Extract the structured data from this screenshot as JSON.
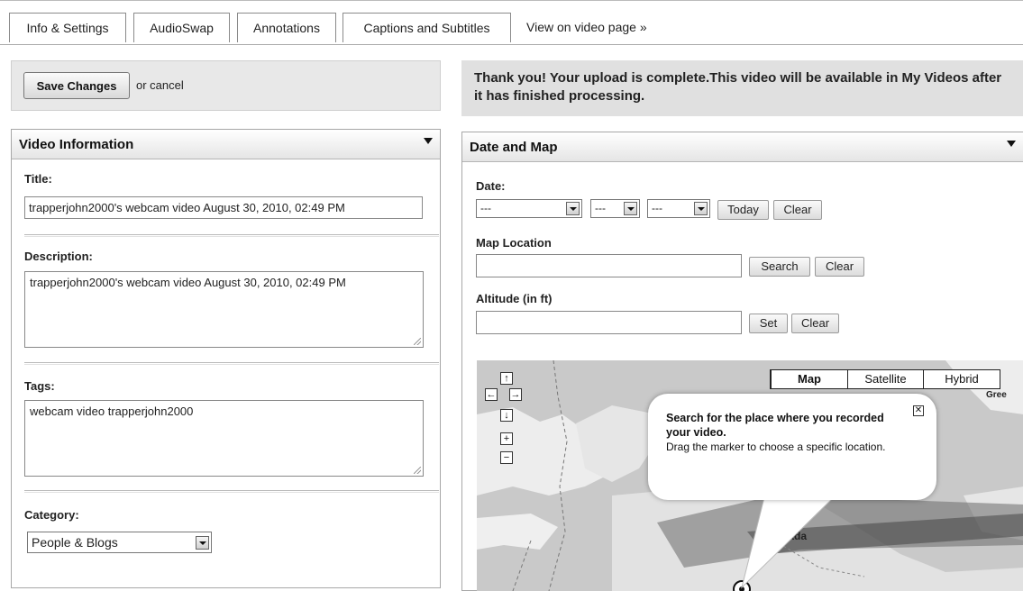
{
  "tabs": [
    {
      "label": "Info & Settings"
    },
    {
      "label": "AudioSwap"
    },
    {
      "label": "Annotations"
    },
    {
      "label": "Captions and Subtitles"
    }
  ],
  "tab_link": "View on video page »",
  "save_bar": {
    "save_label": "Save Changes",
    "cancel_text": "or cancel"
  },
  "banner": {
    "message": "Thank you! Your upload is complete.This video will be available in My Videos after it has finished processing."
  },
  "video_info": {
    "title": "Video Information",
    "title_label": "Title:",
    "title_value": "trapperjohn2000's webcam video August 30, 2010, 02:49 PM",
    "description_label": "Description:",
    "description_value": "trapperjohn2000's webcam video August 30, 2010, 02:49 PM",
    "tags_label": "Tags:",
    "tags_value": "webcam video trapperjohn2000",
    "category_label": "Category:",
    "category_value": "People & Blogs"
  },
  "date_map": {
    "title": "Date and Map",
    "date_label": "Date:",
    "date_month": "---",
    "date_day": "---",
    "date_year": "---",
    "today_label": "Today",
    "clear_label": "Clear",
    "location_label": "Map Location",
    "location_value": "",
    "search_label": "Search",
    "altitude_label": "Altitude (in ft)",
    "altitude_value": "",
    "set_label": "Set"
  },
  "map": {
    "types": [
      "Map",
      "Satellite",
      "Hybrid"
    ],
    "active_type": "Map",
    "nav": {
      "up": "↑",
      "left": "←",
      "right": "→",
      "down": "↓",
      "zoom_in": "+",
      "zoom_out": "−"
    },
    "label_greenland": "Gree",
    "label_canada": "nada",
    "bubble": {
      "heading": "Search for the place where you recorded your video.",
      "body": "Drag the marker to choose a specific location.",
      "close": "✕"
    }
  },
  "colors": {
    "banner_bg": "#e0e0e0",
    "panel_header": "#e5e5e5",
    "map_bg": "#c7c7c7"
  }
}
